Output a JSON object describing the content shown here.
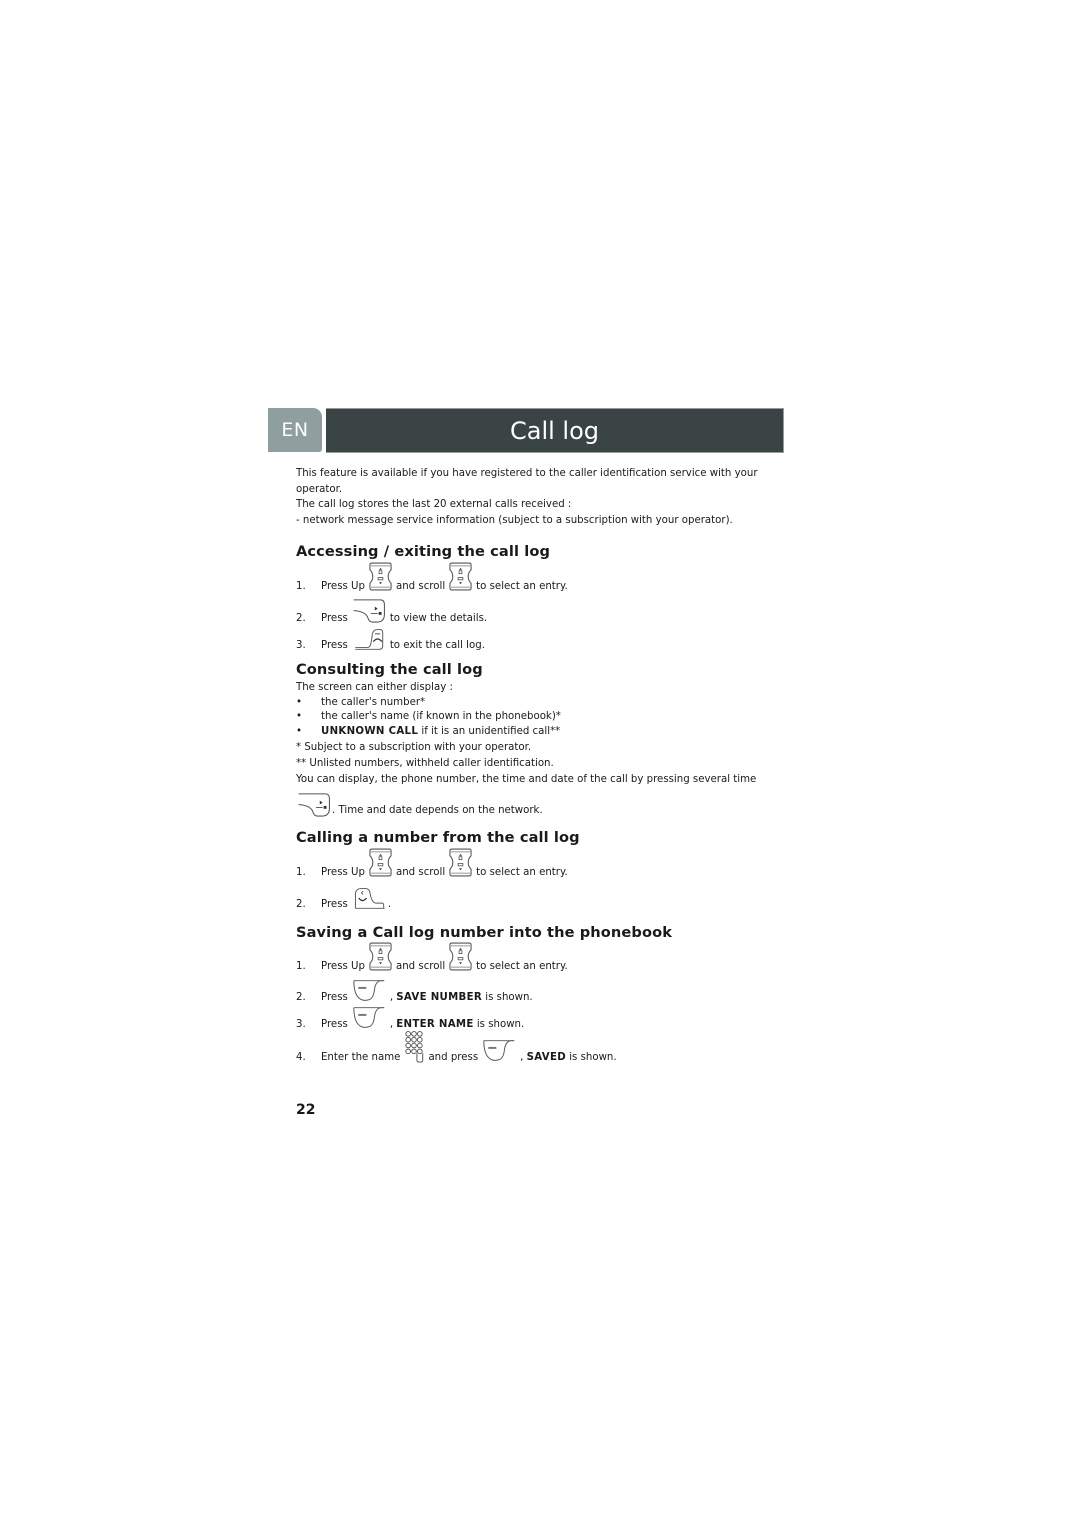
{
  "header": {
    "language_tab": "EN",
    "title": "Call log"
  },
  "intro": {
    "line1": "This feature is available if you have registered to the caller identification service with your",
    "line1b": "operator.",
    "line2": "The call log stores the last 20 external calls received :",
    "line3": "- network message service information (subject to a subscription with your operator)."
  },
  "sections": {
    "accessing": {
      "heading": "Accessing / exiting the call log",
      "steps": [
        {
          "num": "1.",
          "a": "Press Up",
          "icon1": "up-down-nav-key-icon",
          "b": "and scroll",
          "icon2": "up-down-nav-key-icon",
          "c": "to select an entry."
        },
        {
          "num": "2.",
          "a": "Press",
          "icon1": "right-softkey-icon",
          "b": "to view the details."
        },
        {
          "num": "3.",
          "a": "Press",
          "icon1": "hang-up-key-icon",
          "b": "to exit the call log."
        }
      ]
    },
    "consulting": {
      "heading": "Consulting the call log",
      "lead": "The screen can either display :",
      "bullets": [
        {
          "dot": "•",
          "text": "the caller's number*"
        },
        {
          "dot": "•",
          "text": "the caller's name (if known in the phonebook)*"
        },
        {
          "dot": "•",
          "bold": "UNKNOWN CALL",
          "text": " if it is an unidentified call**"
        }
      ],
      "note1": "*  Subject to a subscription with your operator.",
      "note2": "**  Unlisted numbers, withheld caller identification.",
      "para": "You can display, the phone number, the time and date of the call by pressing several time",
      "para_end": ". Time and date depends on the network."
    },
    "calling": {
      "heading": "Calling a number from the call log",
      "steps": [
        {
          "num": "1.",
          "a": "Press Up",
          "b": "and scroll",
          "c": "to select an entry."
        },
        {
          "num": "2.",
          "a": "Press",
          "b": "."
        }
      ]
    },
    "saving": {
      "heading": "Saving a Call log number into the phonebook",
      "steps": [
        {
          "num": "1.",
          "a": "Press Up",
          "b": "and scroll",
          "c": "to select an entry."
        },
        {
          "num": "2.",
          "a": "Press",
          "b": ", ",
          "bold": "SAVE NUMBER",
          "c": " is shown."
        },
        {
          "num": "3.",
          "a": "Press",
          "b": ", ",
          "bold": "ENTER NAME",
          "c": " is shown."
        },
        {
          "num": "4.",
          "a": "Enter the name",
          "b": "and press",
          "c": ", ",
          "bold": "SAVED",
          "d": " is shown."
        }
      ]
    }
  },
  "footer": {
    "page_number": "22"
  },
  "colors": {
    "title_bar": "#3b4444",
    "language_tab": "#8f9e9e"
  }
}
